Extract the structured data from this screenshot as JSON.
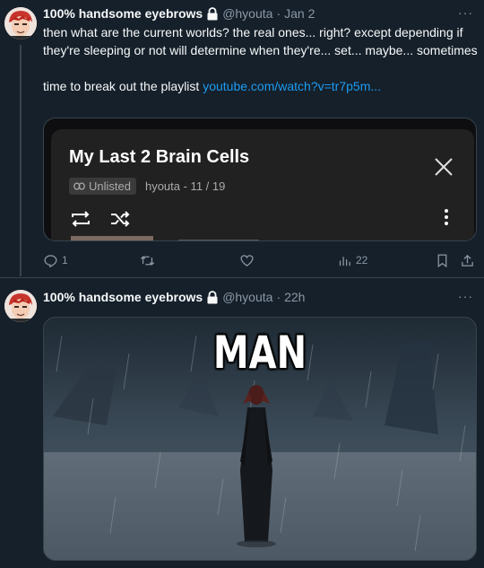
{
  "tweets": [
    {
      "author_name": "100% handsome eyebrows",
      "handle": "@hyouta",
      "separator": "·",
      "time": "Jan 2",
      "more": "···",
      "text_line1": "then what are the current worlds? the real ones... right? except depending if they're sleeping or not will determine when they're... set... maybe... sometimes",
      "text_line2_prefix": "time to break out the playlist ",
      "link_text": "youtube.com/watch?v=tr7p5m...",
      "card": {
        "title": "My Last 2 Brain Cells",
        "badge": "Unlisted",
        "subtitle": "hyouta - 11 / 19",
        "icons": [
          "loop-icon",
          "shuffle-icon",
          "close-icon",
          "kebab-menu-icon"
        ]
      },
      "actions": {
        "reply_count": "1",
        "retweet_count": "",
        "like_count": "",
        "views_count": "22"
      }
    },
    {
      "author_name": "100% handsome eyebrows",
      "handle": "@hyouta",
      "separator": "·",
      "time": "22h",
      "more": "···",
      "image_caption": "MAN"
    }
  ],
  "colors": {
    "background": "#15202b",
    "border": "#38444d",
    "text": "#f7f9f9",
    "muted": "#8b98a5",
    "link": "#1d9bf0"
  }
}
